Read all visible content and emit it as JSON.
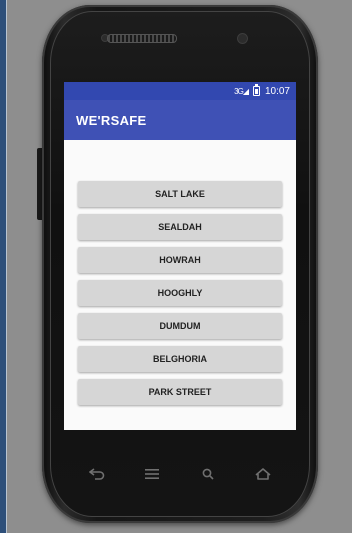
{
  "device": {
    "status_time": "10:07",
    "signal_label": "3G",
    "icons": [
      "signal-icon",
      "battery-icon",
      "back-icon",
      "recent-apps-icon",
      "search-icon",
      "home-icon"
    ]
  },
  "app": {
    "title": "WE'RSAFE",
    "accent_color": "#3f51b5"
  },
  "locations": [
    {
      "label": "SALT LAKE"
    },
    {
      "label": "SEALDAH"
    },
    {
      "label": "HOWRAH"
    },
    {
      "label": "HOOGHLY"
    },
    {
      "label": "DUMDUM"
    },
    {
      "label": "BELGHORIA"
    },
    {
      "label": "PARK STREET"
    }
  ]
}
